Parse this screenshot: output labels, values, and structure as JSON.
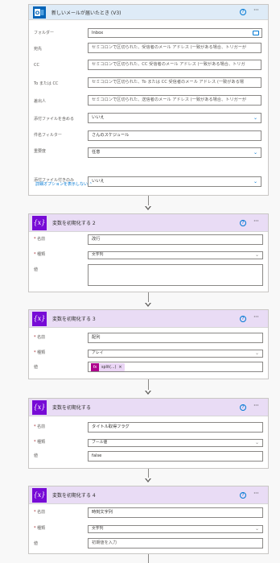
{
  "trigger": {
    "title": "新しいメールが届いたとき (V3)",
    "help": "?",
    "more": "···",
    "fields": [
      {
        "label": "フォルダー",
        "value": "Inbox",
        "kind": "folder",
        "placeholder": false
      },
      {
        "label": "宛先",
        "value": "セミコロンで区切られた、受信者のメール アドレス (一致がある場合、トリガーが",
        "kind": "text",
        "placeholder": true
      },
      {
        "label": "CC",
        "value": "セミコロンで区切られた、CC 受信者のメール アドレス (一致がある場合、トリガ",
        "kind": "text",
        "placeholder": true
      },
      {
        "label": "To または CC",
        "value": "セミコロンで区切られた、To または CC 受信者のメール アドレス (一致がある場",
        "kind": "text",
        "placeholder": true
      },
      {
        "label": "差出人",
        "value": "セミコロンで区切られた、送信者のメール アドレス (一致がある場合、トリガーが",
        "kind": "text",
        "placeholder": true
      },
      {
        "label": "添付ファイルを含める",
        "value": "いいえ",
        "kind": "select",
        "placeholder": false
      },
      {
        "label": "件名フィルター",
        "value": "さんのスケジュール",
        "kind": "text",
        "placeholder": false
      },
      {
        "label": "重要度",
        "value": "任意",
        "kind": "select",
        "placeholder": false
      },
      {
        "label": "添付ファイル付きのみ",
        "value": "いいえ",
        "kind": "select",
        "placeholder": false
      }
    ],
    "advanced_link": "詳細オプションを表示しない"
  },
  "vars": [
    {
      "title": "変数を初期化する 2",
      "name_label": "名前",
      "name_value": "改行",
      "type_label": "種類",
      "type_value": "文字列",
      "value_label": "値",
      "value_value": ""
    },
    {
      "title": "変数を初期化する 3",
      "name_label": "名前",
      "name_value": "配列",
      "type_label": "種類",
      "type_value": "アレイ",
      "value_label": "値",
      "token_icon": "fx",
      "token_text": "split(...)",
      "token_close": "×"
    },
    {
      "title": "変数を初期化する",
      "name_label": "名前",
      "name_value": "タイトル取得フラグ",
      "type_label": "種類",
      "type_value": "ブール値",
      "value_label": "値",
      "value_value": "false"
    },
    {
      "title": "変数を初期化する 4",
      "name_label": "名前",
      "name_value": "時刻文字列",
      "type_label": "種類",
      "type_value": "文字列",
      "value_label": "値",
      "value_value": "初期値を入力"
    }
  ],
  "required_mark": "*",
  "colors": {
    "outlook_header": "#deebf7",
    "variable_header": "#e9dcf5",
    "variable_icon": "#770bd6",
    "accent": "#0078d4",
    "expression": "#ad008c"
  },
  "icons": {
    "trigger": "outlook-icon",
    "variable": "variable-icon",
    "help": "help-circle-icon",
    "more": "more-icon",
    "chevron": "chevron-down-icon",
    "folder": "folder-icon",
    "expression": "fx-icon",
    "close": "close-icon"
  }
}
